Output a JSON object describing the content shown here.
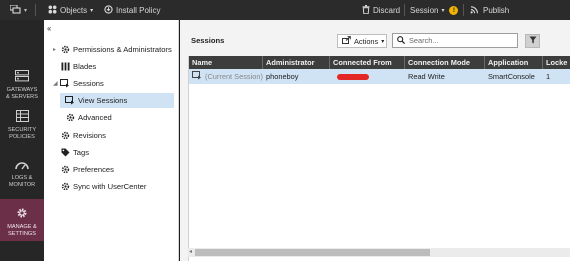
{
  "colors": {
    "accent_nav_active": "#6b2f47",
    "selection": "#cfe3f5",
    "grid_header": "#3d3d3d",
    "session_badge": "#f0b400",
    "redaction": "#e32727"
  },
  "topbar": {
    "menu_icon": "app-menu-icon",
    "objects_label": "Objects",
    "install_policy_label": "Install Policy",
    "discard_label": "Discard",
    "session_label": "Session",
    "session_badge": "!",
    "publish_label": "Publish"
  },
  "left_nav": [
    {
      "label_1": "GATEWAYS",
      "label_2": "& SERVERS",
      "icon": "gateways-icon",
      "active": false
    },
    {
      "label_1": "SECURITY",
      "label_2": "POLICIES",
      "icon": "security-policies-icon",
      "active": false
    },
    {
      "label_1": "LOGS &",
      "label_2": "MONITOR",
      "icon": "logs-monitor-icon",
      "active": false
    },
    {
      "label_1": "MANAGE &",
      "label_2": "SETTINGS",
      "icon": "manage-settings-icon",
      "active": true
    }
  ],
  "tree": {
    "collapse_label": "‹‹",
    "items": [
      {
        "label": "Permissions & Administrators",
        "icon": "gear-icon",
        "level": 0,
        "expandable": true,
        "expanded": false
      },
      {
        "label": "Blades",
        "icon": "blades-icon",
        "level": 0,
        "expandable": false
      },
      {
        "label": "Sessions",
        "icon": "sessions-icon",
        "level": 0,
        "expandable": true,
        "expanded": true
      },
      {
        "label": "View Sessions",
        "icon": "sessions-icon",
        "level": 1,
        "selected": true
      },
      {
        "label": "Advanced",
        "icon": "gear-icon",
        "level": 1
      },
      {
        "label": "Revisions",
        "icon": "gear-icon",
        "level": 0
      },
      {
        "label": "Tags",
        "icon": "tag-icon",
        "level": 0
      },
      {
        "label": "Preferences",
        "icon": "gear-icon",
        "level": 0
      },
      {
        "label": "Sync with UserCenter",
        "icon": "gear-icon",
        "level": 0
      }
    ]
  },
  "main": {
    "title": "Sessions",
    "actions_label": "Actions",
    "search_placeholder": "Search...",
    "columns": [
      "Name",
      "Administrator",
      "Connected From",
      "Connection Mode",
      "Application",
      "Locke"
    ],
    "rows": [
      {
        "name": "(Current Session)",
        "administrator": "phoneboy",
        "connected_from": "",
        "connection_mode": "Read Write",
        "application": "SmartConsole",
        "locked": "1"
      }
    ]
  }
}
